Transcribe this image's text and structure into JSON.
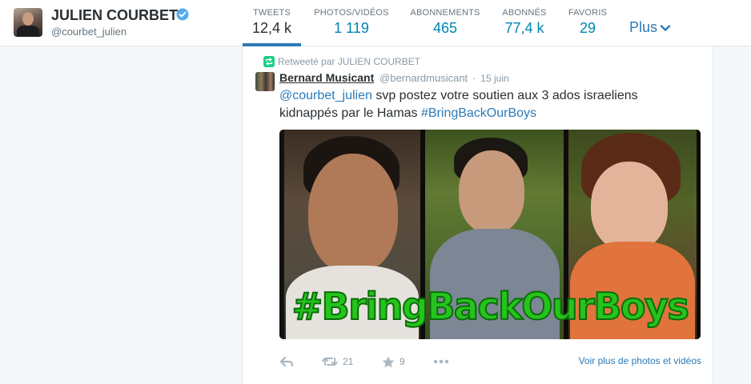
{
  "profile": {
    "name": "JULIEN COURBET",
    "handle": "@courbet_julien",
    "verified_color": "#55acee"
  },
  "nav": {
    "tabs": [
      {
        "label": "TWEETS",
        "value": "12,4 k",
        "active": true
      },
      {
        "label": "PHOTOS/VIDÉOS",
        "value": "1 119",
        "active": false
      },
      {
        "label": "ABONNEMENTS",
        "value": "465",
        "active": false
      },
      {
        "label": "ABONNÉS",
        "value": "77,4 k",
        "active": false
      },
      {
        "label": "FAVORIS",
        "value": "29",
        "active": false
      }
    ],
    "more_label": "Plus"
  },
  "tweet": {
    "retweeted_by": "Retweeté par JULIEN COURBET",
    "author_name": "Bernard Musicant",
    "author_handle": "@bernardmusicant",
    "separator": "·",
    "date": "15 juin",
    "mention": "@courbet_julien",
    "text_main": " svp postez votre soutien aux 3 ados israeliens kidnappés par le Hamas ",
    "hashtag_link": "#BringBackOurBoys",
    "image_text": "#BringBackOurBoys",
    "retweet_count": "21",
    "favorite_count": "9",
    "view_more": "Voir plus de photos et vidéos"
  },
  "icons": {
    "verified": "verified-badge-icon",
    "more": "chevron-down-icon",
    "retweeted": "retweet-icon",
    "reply": "reply-icon",
    "retweet": "retweet-icon",
    "favorite": "star-icon",
    "more_actions": "more-dots-icon"
  },
  "colors": {
    "link": "#2b7bb9",
    "stat_value": "#0084b4",
    "retweet_green": "#19cf86",
    "hashtag_green": "#25c41d"
  }
}
